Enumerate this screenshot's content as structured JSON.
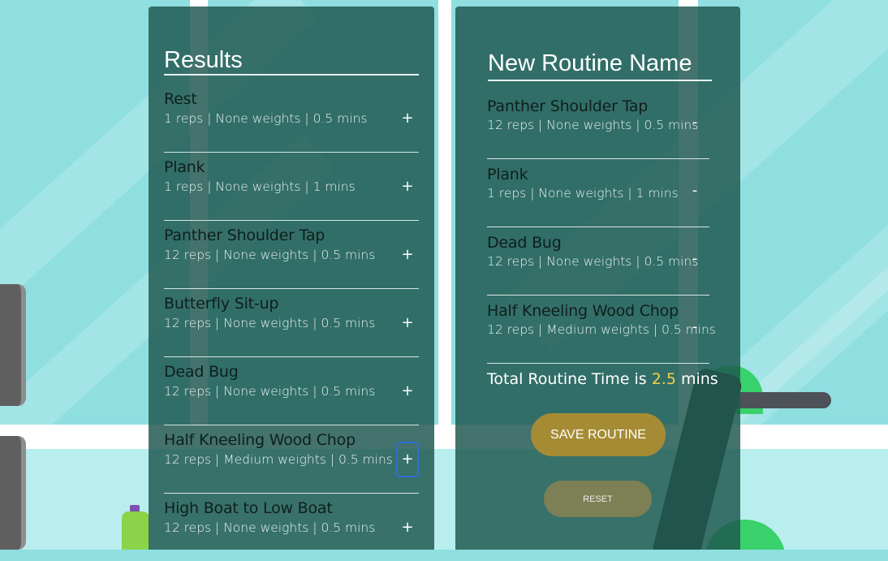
{
  "results": {
    "title": "Results",
    "items": [
      {
        "name": "Rest",
        "meta": "1 reps | None weights | 0.5 mins",
        "action": "+"
      },
      {
        "name": "Plank",
        "meta": "1 reps | None weights | 1 mins",
        "action": "+"
      },
      {
        "name": "Panther Shoulder Tap",
        "meta": "12 reps | None weights | 0.5 mins",
        "action": "+"
      },
      {
        "name": "Butterfly Sit-up",
        "meta": "12 reps | None weights | 0.5 mins",
        "action": "+"
      },
      {
        "name": "Dead Bug",
        "meta": "12 reps | None weights | 0.5 mins",
        "action": "+"
      },
      {
        "name": "Half Kneeling Wood Chop",
        "meta": "12 reps | Medium weights | 0.5 mins",
        "action": "+"
      },
      {
        "name": "High Boat to Low Boat",
        "meta": "12 reps | None weights | 0.5 mins",
        "action": "+"
      }
    ]
  },
  "routine": {
    "title": "New Routine Name",
    "items": [
      {
        "name": "Panther Shoulder Tap",
        "meta": "12 reps | None weights | 0.5 mins",
        "action": "-"
      },
      {
        "name": "Plank",
        "meta": "1 reps | None weights | 1 mins",
        "action": "-"
      },
      {
        "name": "Dead Bug",
        "meta": "12 reps | None weights | 0.5 mins",
        "action": "-"
      },
      {
        "name": "Half Kneeling Wood Chop",
        "meta": "12 reps | Medium weights | 0.5 mins",
        "action": "-"
      }
    ],
    "total_prefix": "Total Routine Time is",
    "total_value": "2.5",
    "total_suffix": "mins",
    "save_label": "SAVE ROUTINE",
    "reset_label": "RESET"
  },
  "colors": {
    "panel": "#1f5850",
    "accent_total": "#f3d24a",
    "save_button": "#a58c34",
    "reset_button": "#7d7f55",
    "focus_ring": "#2f6fd6"
  }
}
